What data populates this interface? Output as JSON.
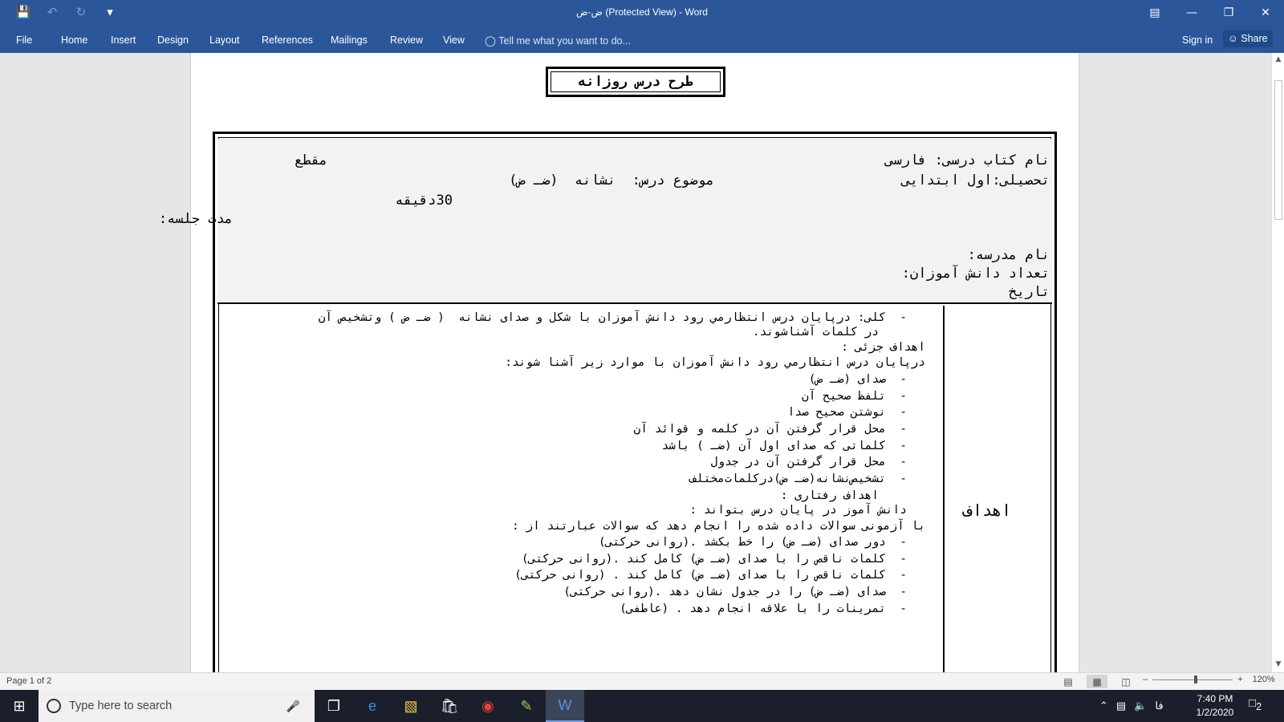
{
  "titlebar": {
    "doc_title": "ض-ض (Protected View) - Word",
    "qat_icons": [
      "save-icon",
      "undo-icon",
      "redo-icon",
      "customize-icon"
    ]
  },
  "ribbon": {
    "tabs": [
      "File",
      "Home",
      "Insert",
      "Design",
      "Layout",
      "References",
      "Mailings",
      "Review",
      "View"
    ],
    "tell_me": "Tell me what you want to do...",
    "sign_in": "Sign in",
    "share": "Share"
  },
  "document": {
    "title": "طرح درس روزانه",
    "header": {
      "book": "نام کتاب درسی: فارسی",
      "section_label": "مقطع",
      "grade": "تحصیلی:اول ابتدایی",
      "subject": "موضوع درس:  نشانه  (ضـ ض)",
      "duration_value": "30دقیقه",
      "duration_label": "مدت جلسه:",
      "school": "نام مدرسه:",
      "students": "تعداد دانش آموزان:",
      "date": "تاریخ"
    },
    "goals_label": "اهداف",
    "goals_lines": [
      "-  کلی: درپایان درس انتظارمي رود دانش آموزان با شکل و صدای نشانه  ( ضـ ض ) وتشخيص آن",
      "در کلمات آشناشوند.",
      "اهداف جزئی :",
      "درپایان درس انتظارمي رود دانش آموزان با موارد زیر آشنا شوند:",
      "-  صدای (ضـ ض)",
      "-  تلفظ صحیح آن",
      "-  نوشتن صحیح صدا",
      "-  محل قرار گرفتن آن در کلمه و قوائد آن",
      "-  کلماتی که صدای اول آن (ضـ ) باشد",
      "-  محل قرار گرفتن آن در جدول",
      "-  تشخیص‌نشانه(ضـ ض)درکلمات‌مختلف",
      "اهداف رفتاری :",
      "دانش آموز در پایان درس بتواند :",
      "با آزمونی سوالات داده شده را انجام دهد که سوالات عبارتند از :",
      "-  دور صدای (ضـ ض) را خط بکشد .(روانی حرکتی)",
      "-  کلمات ناقص را با صدای (ضـ ض) کامل کند .(روانی حرکتی)",
      "-  کلمات ناقص را با صدای (ضـ ض) کامل کند . (روانی حرکتی)",
      "-  صدای (ضـ ض) را در جدول نشان دهد .(روانی حرکتی)",
      "-  تمرینات را با علاقه انجام دهد . (عاطفی)"
    ]
  },
  "statusbar": {
    "page": "Page 1 of 2",
    "zoom": "120%"
  },
  "taskbar": {
    "search_placeholder": "Type here to search",
    "lang": "فا",
    "time": "7:40 PM",
    "date": "1/2/2020",
    "notifications": "2"
  }
}
